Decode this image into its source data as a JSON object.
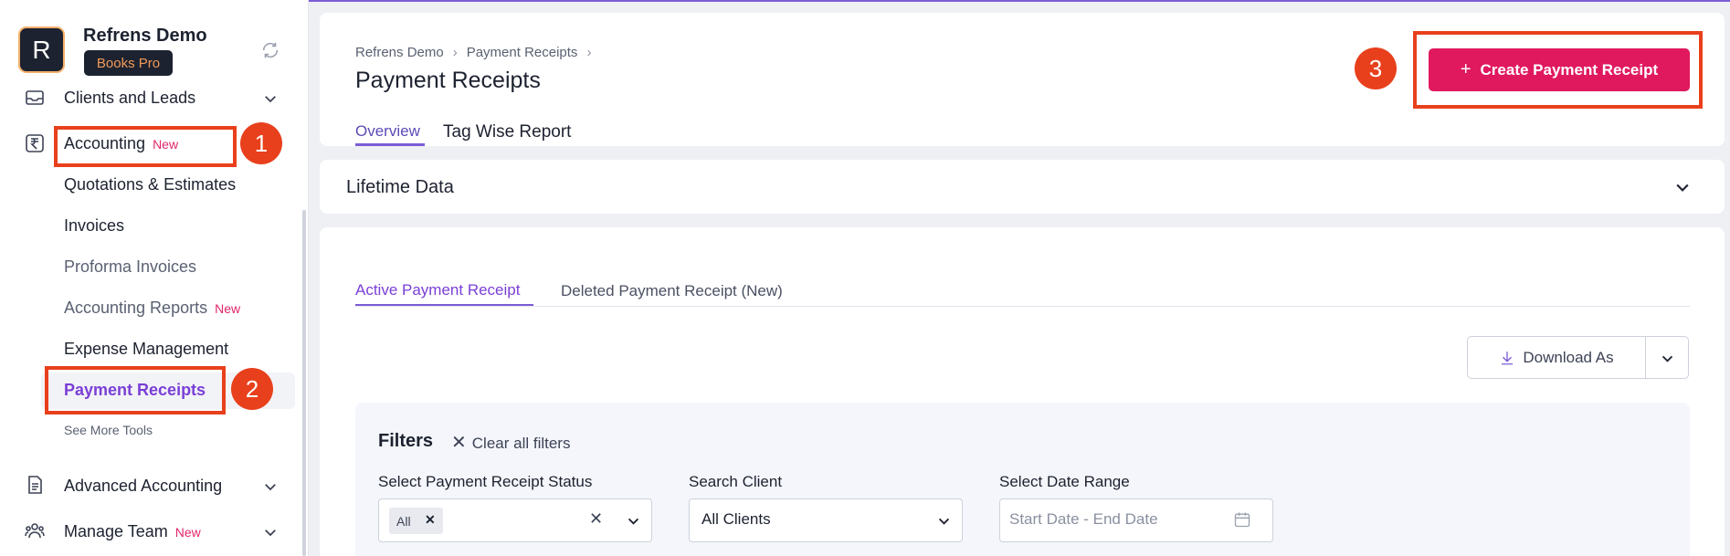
{
  "org": {
    "initial": "R",
    "name": "Refrens Demo",
    "plan": "Books Pro"
  },
  "sidebar": {
    "clients_leads": "Clients and Leads",
    "accounting": "Accounting",
    "new_tag": "New",
    "sub_items": [
      "Quotations & Estimates",
      "Invoices",
      "Proforma Invoices",
      "Accounting Reports",
      "Expense Management",
      "Payment Receipts"
    ],
    "see_more": "See More Tools",
    "advanced_accounting": "Advanced Accounting",
    "manage_team": "Manage Team"
  },
  "annotations": [
    "1",
    "2",
    "3"
  ],
  "header": {
    "breadcrumb": [
      "Refrens Demo",
      "Payment Receipts"
    ],
    "title": "Payment Receipts",
    "tabs": [
      "Overview",
      "Tag Wise Report"
    ],
    "create_button": "Create Payment Receipt"
  },
  "lifetime": {
    "label": "Lifetime Data"
  },
  "content": {
    "tabs": [
      "Active Payment Receipt",
      "Deleted Payment Receipt (New)"
    ],
    "download_label": "Download As"
  },
  "filters": {
    "title": "Filters",
    "clear_label": "Clear all filters",
    "status_label": "Select Payment Receipt Status",
    "status_chip": "All",
    "client_label": "Search Client",
    "client_value": "All Clients",
    "date_label": "Select Date Range",
    "date_placeholder": "Start Date - End Date"
  },
  "colors": {
    "accent": "#7c5cd6",
    "primary_button": "#e0195f",
    "annotation": "#e8401c"
  }
}
